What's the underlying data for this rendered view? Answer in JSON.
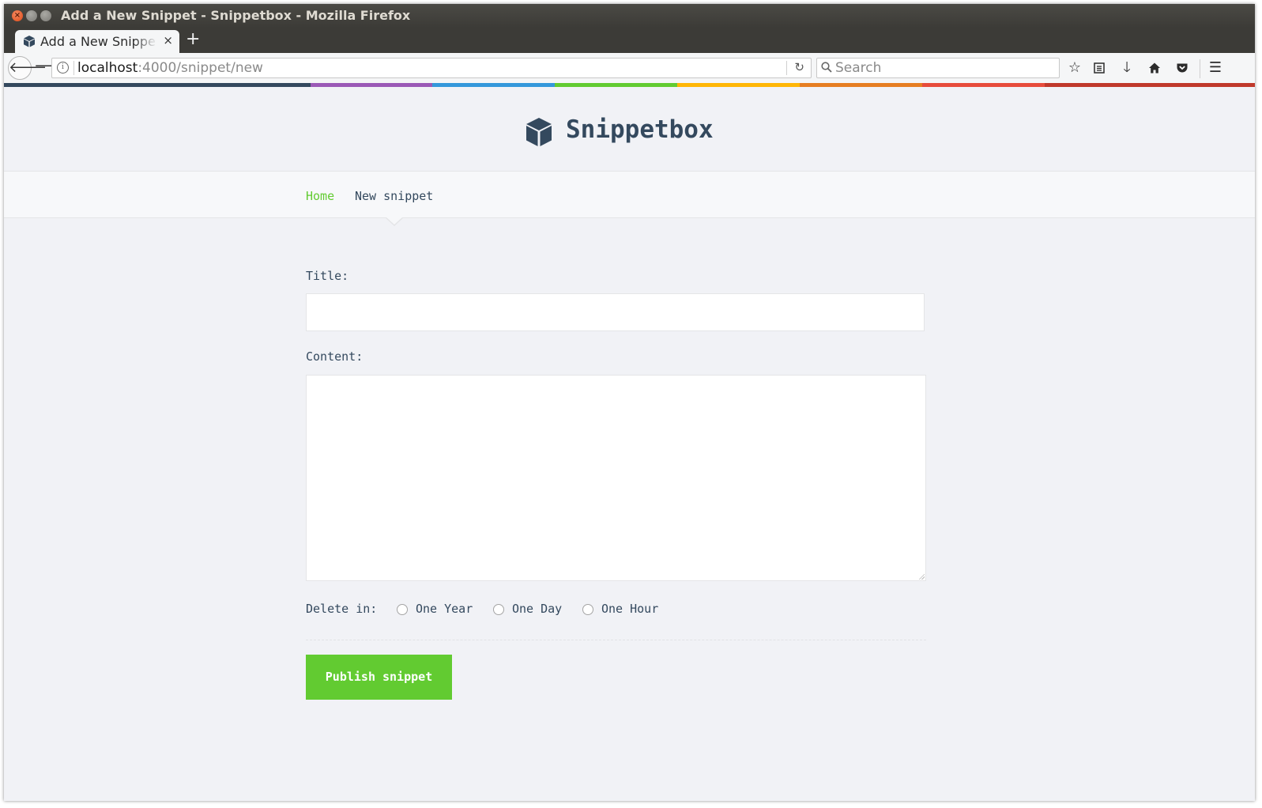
{
  "window": {
    "title": "Add a New Snippet - Snippetbox - Mozilla Firefox"
  },
  "tab": {
    "title": "Add a New Snippet",
    "close_glyph": "×",
    "new_tab_glyph": "+"
  },
  "toolbar": {
    "url_host": "localhost",
    "url_rest": ":4000/snippet/new",
    "search_placeholder": "Search"
  },
  "stripe_colors": [
    "#34495e",
    "#9b59b6",
    "#3498db",
    "#62cb31",
    "#ffb606",
    "#e67e22",
    "#e74c3c",
    "#c0392b"
  ],
  "header": {
    "brand": "Snippetbox"
  },
  "nav": {
    "home": "Home",
    "new_snippet": "New snippet"
  },
  "form": {
    "title_label": "Title:",
    "title_value": "",
    "content_label": "Content:",
    "content_value": "",
    "delete_label": "Delete in:",
    "expires_options": [
      "One Year",
      "One Day",
      "One Hour"
    ],
    "submit_label": "Publish snippet"
  },
  "colors": {
    "accent": "#62cb31",
    "text": "#34495e",
    "background": "#f1f2f6"
  }
}
